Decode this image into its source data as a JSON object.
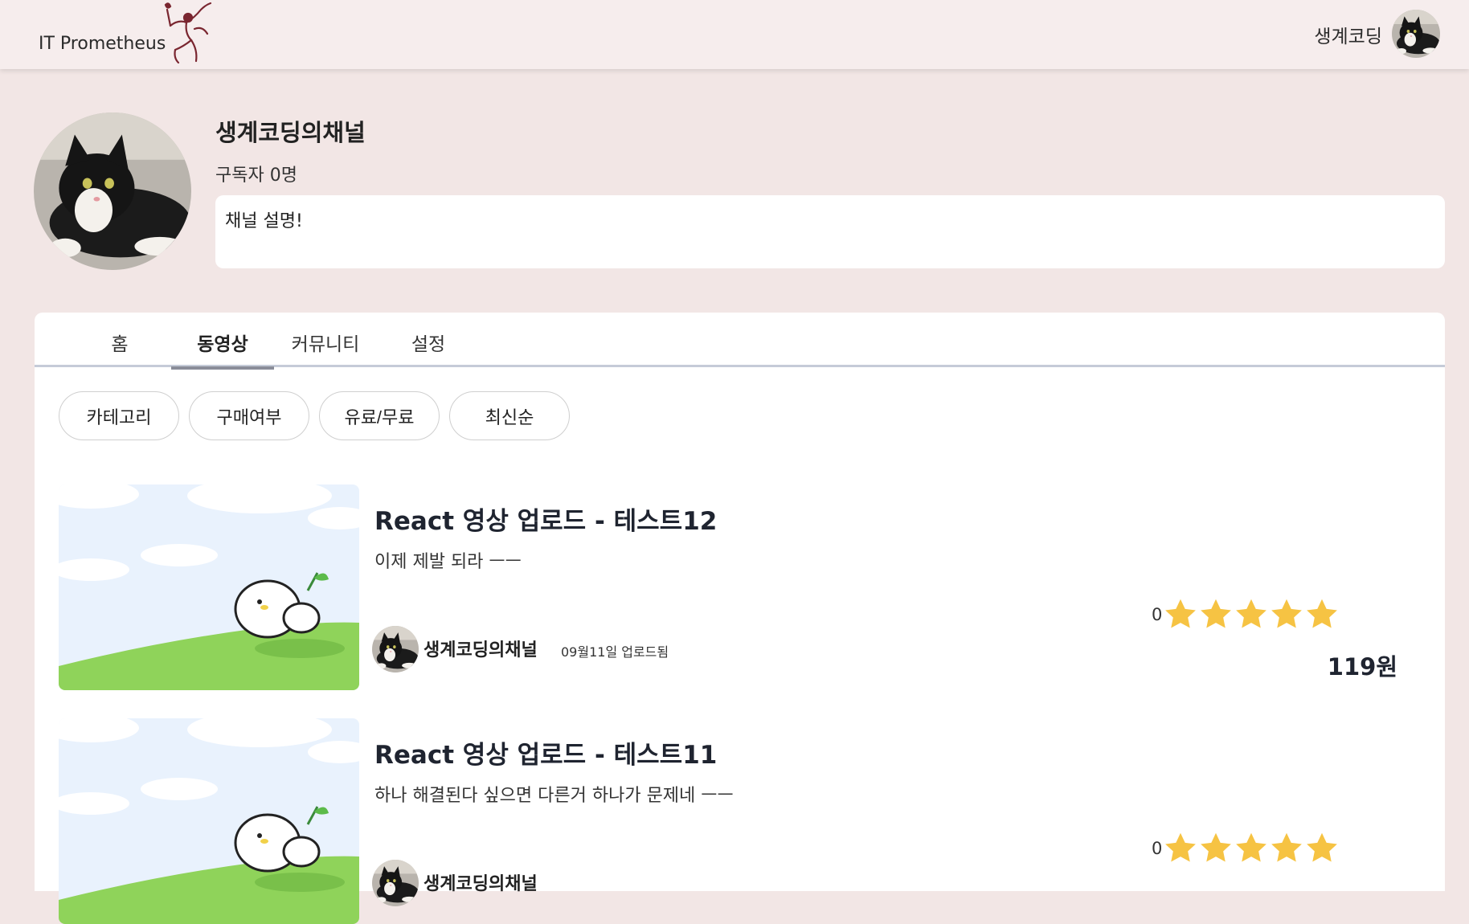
{
  "header": {
    "brand": "IT Prometheus",
    "user_name": "생계코딩"
  },
  "profile": {
    "channel_name": "생계코딩의채널",
    "subscribers": "구독자 0명",
    "description": "채널 설명!"
  },
  "tabs": [
    {
      "label": "홈",
      "active": false
    },
    {
      "label": "동영상",
      "active": true
    },
    {
      "label": "커뮤니티",
      "active": false
    },
    {
      "label": "설정",
      "active": false
    }
  ],
  "filters": [
    "카테고리",
    "구매여부",
    "유료/무료",
    "최신순"
  ],
  "videos": [
    {
      "title": "React 영상 업로드 - 테스트12",
      "description": "이제 제발 되라 ㅡㅡ",
      "channel": "생계코딩의채널",
      "date": "09월11일 업로드됨",
      "rating_count": "0",
      "stars": 5,
      "price": "119원"
    },
    {
      "title": "React 영상 업로드 - 테스트11",
      "description": "하나 해결된다 싶으면 다른거 하나가 문제네 ㅡㅡ",
      "channel": "생계코딩의채널",
      "date": "",
      "rating_count": "0",
      "stars": 5,
      "price": ""
    }
  ],
  "colors": {
    "background": "#f2e6e5",
    "header": "#f6eded",
    "star": "#f6c343",
    "tab_underline": "#c5cbd8"
  }
}
